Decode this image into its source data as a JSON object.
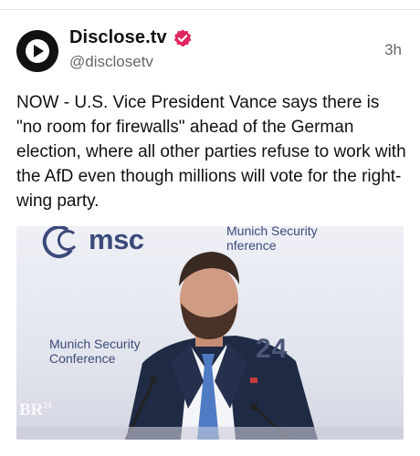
{
  "author": {
    "display_name": "Disclose.tv",
    "handle": "@disclosetv",
    "avatar_icon": "play-circle-icon",
    "verified_icon": "verified-badge-icon",
    "verified_color": "#e0245e"
  },
  "post": {
    "time": "3h",
    "text": "NOW - U.S. Vice President Vance says there is \"no room for firewalls\" ahead of the German election, where all other parties refuse to work with the AfD even though millions will vote for the right-wing party."
  },
  "media": {
    "logo_text": "msc",
    "banner_top": "Munich Security\nnference",
    "banner_left": "Munich Security\nConference",
    "year_text": "24",
    "watermark_main": "BR",
    "watermark_sup": "24"
  }
}
